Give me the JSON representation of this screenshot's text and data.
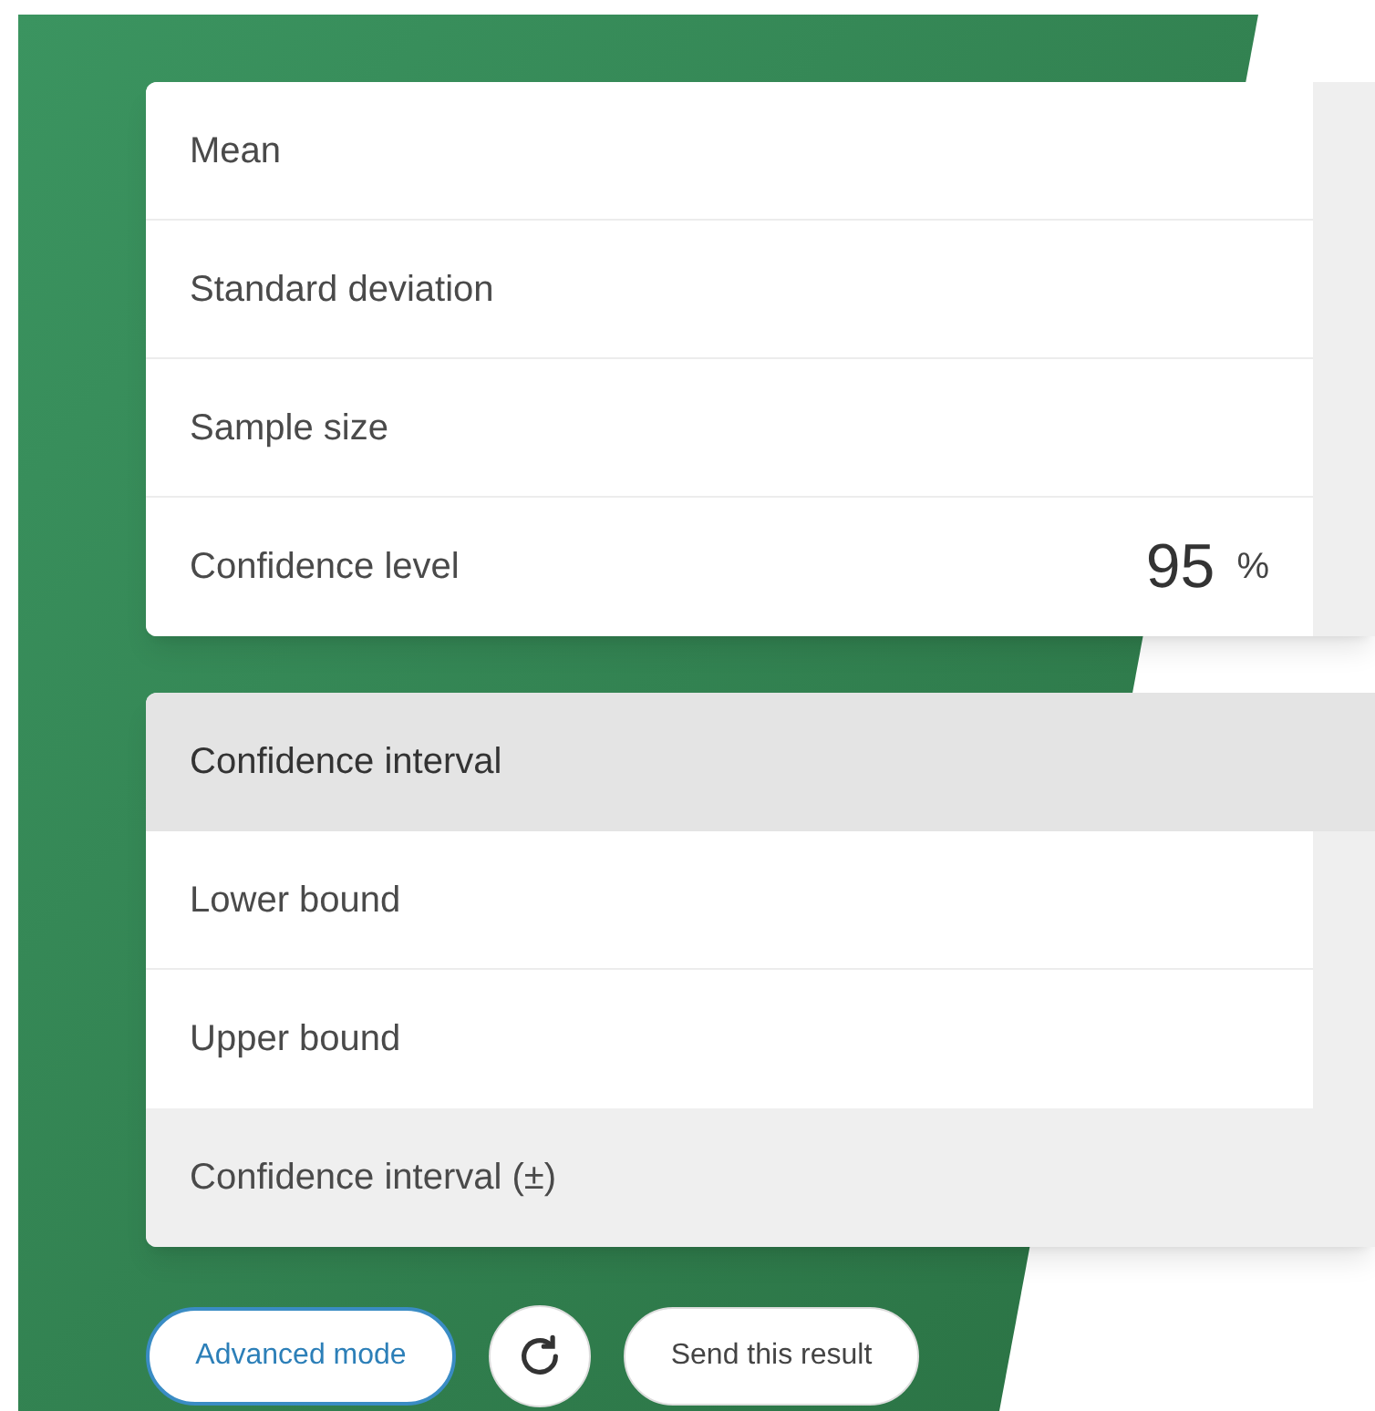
{
  "inputs": [
    {
      "label": "Mean"
    },
    {
      "label": "Standard deviation"
    },
    {
      "label": "Sample size"
    },
    {
      "label": "Confidence level",
      "value": "95",
      "unit": "%"
    }
  ],
  "results": [
    {
      "kind": "header",
      "label": "Confidence interval"
    },
    {
      "kind": "field",
      "label": "Lower bound"
    },
    {
      "kind": "field",
      "label": "Upper bound"
    },
    {
      "kind": "total",
      "label": "Confidence interval (±)"
    }
  ],
  "buttons": [
    {
      "kind": "text",
      "label": "Advanced mode",
      "selected": true
    },
    {
      "kind": "reload"
    },
    {
      "kind": "text",
      "label": "Send this result",
      "selected": false
    }
  ]
}
